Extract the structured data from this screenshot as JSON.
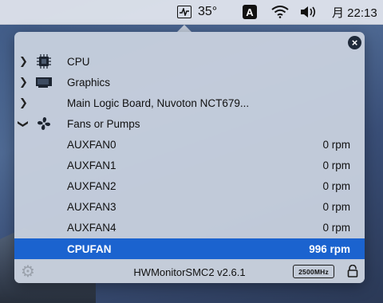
{
  "menubar": {
    "temperature": "35°",
    "input_source": "A",
    "clock": "月 22:13"
  },
  "popover": {
    "sections": [
      {
        "label": "CPU",
        "expanded": false,
        "icon": "cpu-chip-icon"
      },
      {
        "label": "Graphics",
        "expanded": false,
        "icon": "graphics-card-icon"
      },
      {
        "label": "Main Logic Board, Nuvoton NCT679...",
        "expanded": false,
        "icon": ""
      },
      {
        "label": "Fans or Pumps",
        "expanded": true,
        "icon": "fan-icon"
      }
    ],
    "fans": [
      {
        "name": "AUXFAN0",
        "value": "0 rpm"
      },
      {
        "name": "AUXFAN1",
        "value": "0 rpm"
      },
      {
        "name": "AUXFAN2",
        "value": "0 rpm"
      },
      {
        "name": "AUXFAN3",
        "value": "0 rpm"
      },
      {
        "name": "AUXFAN4",
        "value": "0 rpm"
      },
      {
        "name": "CPUFAN",
        "value": "996 rpm",
        "selected": true
      }
    ],
    "footer": {
      "app_title": "HWMonitorSMC2 v2.6.1",
      "frequency_badge": "2500MHz"
    }
  },
  "colors": {
    "selection": "#1b63cf",
    "popover_bg": "#c8d1de"
  }
}
